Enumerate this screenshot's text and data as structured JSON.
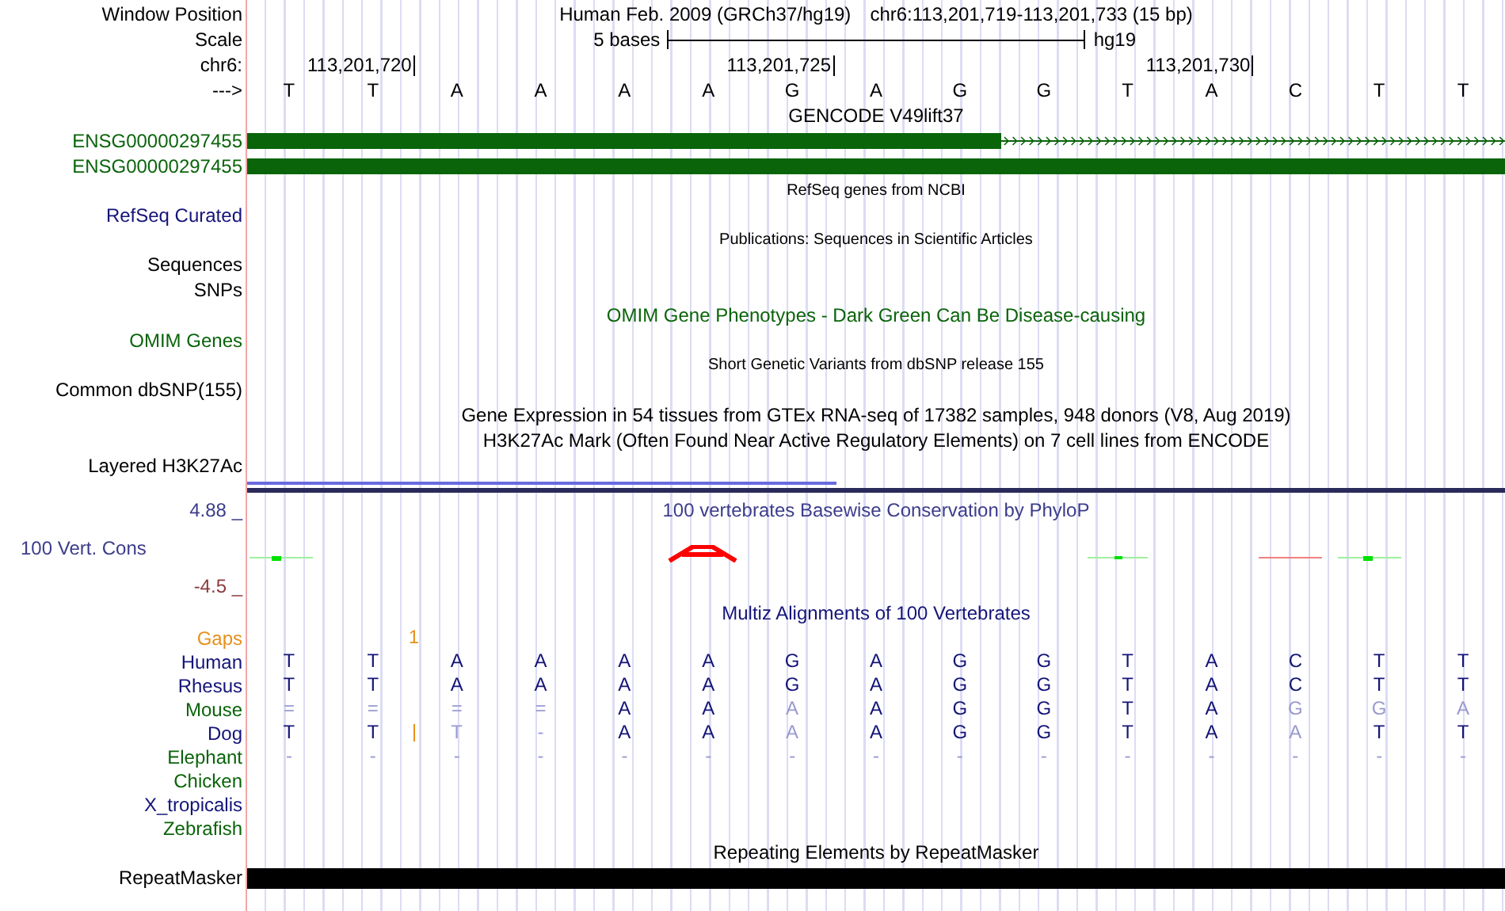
{
  "header": {
    "window_label": "Window Position",
    "assembly": "Human Feb. 2009 (GRCh37/hg19)",
    "position": "chr6:113,201,719-113,201,733 (15 bp)",
    "scale_label": "Scale",
    "scale_text": "5 bases",
    "scale_assembly": "hg19",
    "chrom_label": "chr6:",
    "ruler_ticks": [
      "113,201,720",
      "113,201,725",
      "113,201,730"
    ],
    "strand_label": "--->",
    "bases": [
      "T",
      "T",
      "A",
      "A",
      "A",
      "A",
      "G",
      "A",
      "G",
      "G",
      "T",
      "A",
      "C",
      "T",
      "T"
    ]
  },
  "tracks": [
    {
      "kind": "title",
      "text": "GENCODE V49lift37",
      "color": "#000000"
    },
    {
      "kind": "gene",
      "label": "ENSG00000297455",
      "color": "#0a640a",
      "parts": [
        {
          "kind": "exon"
        },
        {
          "kind": "exon"
        },
        {
          "kind": "exon"
        },
        {
          "kind": "exon"
        },
        {
          "kind": "exon"
        },
        {
          "kind": "exon"
        },
        {
          "kind": "exon"
        },
        {
          "kind": "exon"
        },
        {
          "kind": "exon"
        },
        {
          "kind": "intron"
        },
        {
          "kind": "intron"
        },
        {
          "kind": "intron"
        },
        {
          "kind": "intron"
        },
        {
          "kind": "intron"
        },
        {
          "kind": "intron"
        }
      ]
    },
    {
      "kind": "gene",
      "label": "ENSG00000297455",
      "color": "#0a640a",
      "parts": [
        {
          "kind": "exon"
        },
        {
          "kind": "exon"
        },
        {
          "kind": "exon"
        },
        {
          "kind": "exon"
        },
        {
          "kind": "exon"
        },
        {
          "kind": "exon"
        },
        {
          "kind": "exon"
        },
        {
          "kind": "exon"
        },
        {
          "kind": "exon"
        },
        {
          "kind": "exon"
        },
        {
          "kind": "exon"
        },
        {
          "kind": "exon"
        },
        {
          "kind": "exon"
        },
        {
          "kind": "exon"
        },
        {
          "kind": "exon"
        }
      ]
    },
    {
      "kind": "small-title",
      "text": "RefSeq genes from NCBI",
      "color": "#000000"
    },
    {
      "kind": "label",
      "label": "RefSeq Curated",
      "color": "#141478"
    },
    {
      "kind": "small-title",
      "text": "Publications: Sequences in Scientific Articles",
      "color": "#000000"
    },
    {
      "kind": "label",
      "label": "Sequences",
      "color": "#000000"
    },
    {
      "kind": "label",
      "label": "SNPs",
      "color": "#000000"
    },
    {
      "kind": "title",
      "text": "OMIM Gene Phenotypes - Dark Green Can Be Disease-causing",
      "color": "#0a640a"
    },
    {
      "kind": "label",
      "label": "OMIM Genes",
      "color": "#0a640a"
    },
    {
      "kind": "small-title",
      "text": "Short Genetic Variants from dbSNP release 155",
      "color": "#000000"
    },
    {
      "kind": "label",
      "label": "Common dbSNP(155)",
      "color": "#000000"
    },
    {
      "kind": "title",
      "text": "Gene Expression in 54 tissues from GTEx RNA-seq of 17382 samples, 948 donors (V8, Aug 2019)",
      "color": "#000000"
    },
    {
      "kind": "title",
      "text": "H3K27Ac Mark (Often Found Near Active Regulatory Elements) on 7 cell lines from ENCODE",
      "color": "#000000"
    },
    {
      "kind": "label",
      "label": "Layered H3K27Ac",
      "color": "#000000"
    },
    {
      "kind": "signal"
    },
    {
      "kind": "conservation",
      "title": "100 vertebrates Basewise Conservation by PhyloP",
      "label": "100 Vert. Cons",
      "color": "#3c3c8c",
      "y_max": "4.88 _",
      "y_min": "-4.5 _"
    },
    {
      "kind": "alignment",
      "title": "Multiz Alignments of 100 Vertebrates",
      "color": "#141478",
      "gaps": {
        "label": "Gaps",
        "color": "#e8901c",
        "cells": [
          {},
          {},
          {
            "count": "1"
          },
          {},
          {},
          {},
          {},
          {},
          {},
          {},
          {},
          {},
          {},
          {},
          {}
        ]
      },
      "species": [
        {
          "label": "Human",
          "color": "#141478",
          "cells": [
            {
              "base": "T",
              "faded": false,
              "insertion": false
            },
            {
              "base": "T",
              "faded": false,
              "insertion": false
            },
            {
              "base": "A",
              "faded": false,
              "insertion": false
            },
            {
              "base": "A",
              "faded": false,
              "insertion": false
            },
            {
              "base": "A",
              "faded": false,
              "insertion": false
            },
            {
              "base": "A",
              "faded": false,
              "insertion": false
            },
            {
              "base": "G",
              "faded": false,
              "insertion": false
            },
            {
              "base": "A",
              "faded": false,
              "insertion": false
            },
            {
              "base": "G",
              "faded": false,
              "insertion": false
            },
            {
              "base": "G",
              "faded": false,
              "insertion": false
            },
            {
              "base": "T",
              "faded": false,
              "insertion": false
            },
            {
              "base": "A",
              "faded": false,
              "insertion": false
            },
            {
              "base": "C",
              "faded": false,
              "insertion": false
            },
            {
              "base": "T",
              "faded": false,
              "insertion": false
            },
            {
              "base": "T",
              "faded": false,
              "insertion": false
            }
          ]
        },
        {
          "label": "Rhesus",
          "color": "#141478",
          "cells": [
            {
              "base": "T",
              "faded": false,
              "insertion": false
            },
            {
              "base": "T",
              "faded": false,
              "insertion": false
            },
            {
              "base": "A",
              "faded": false,
              "insertion": false
            },
            {
              "base": "A",
              "faded": false,
              "insertion": false
            },
            {
              "base": "A",
              "faded": false,
              "insertion": false
            },
            {
              "base": "A",
              "faded": false,
              "insertion": false
            },
            {
              "base": "G",
              "faded": false,
              "insertion": false
            },
            {
              "base": "A",
              "faded": false,
              "insertion": false
            },
            {
              "base": "G",
              "faded": false,
              "insertion": false
            },
            {
              "base": "G",
              "faded": false,
              "insertion": false
            },
            {
              "base": "T",
              "faded": false,
              "insertion": false
            },
            {
              "base": "A",
              "faded": false,
              "insertion": false
            },
            {
              "base": "C",
              "faded": false,
              "insertion": false
            },
            {
              "base": "T",
              "faded": false,
              "insertion": false
            },
            {
              "base": "T",
              "faded": false,
              "insertion": false
            }
          ]
        },
        {
          "label": "Mouse",
          "color": "#0a640a",
          "cells": [
            {
              "base": "=",
              "faded": true,
              "insertion": false
            },
            {
              "base": "=",
              "faded": true,
              "insertion": false
            },
            {
              "base": "=",
              "faded": true,
              "insertion": false
            },
            {
              "base": "=",
              "faded": true,
              "insertion": false
            },
            {
              "base": "A",
              "faded": false,
              "insertion": false
            },
            {
              "base": "A",
              "faded": false,
              "insertion": false
            },
            {
              "base": "A",
              "faded": true,
              "insertion": false
            },
            {
              "base": "A",
              "faded": false,
              "insertion": false
            },
            {
              "base": "G",
              "faded": false,
              "insertion": false
            },
            {
              "base": "G",
              "faded": false,
              "insertion": false
            },
            {
              "base": "T",
              "faded": false,
              "insertion": false
            },
            {
              "base": "A",
              "faded": false,
              "insertion": false
            },
            {
              "base": "G",
              "faded": true,
              "insertion": false
            },
            {
              "base": "G",
              "faded": true,
              "insertion": false
            },
            {
              "base": "A",
              "faded": true,
              "insertion": false
            }
          ]
        },
        {
          "label": "Dog",
          "color": "#141478",
          "cells": [
            {
              "base": "T",
              "faded": false,
              "insertion": false
            },
            {
              "base": "T",
              "faded": false,
              "insertion": false
            },
            {
              "base": "T",
              "faded": true,
              "insertion": true
            },
            {
              "base": "-",
              "faded": true,
              "insertion": false
            },
            {
              "base": "A",
              "faded": false,
              "insertion": false
            },
            {
              "base": "A",
              "faded": false,
              "insertion": false
            },
            {
              "base": "A",
              "faded": true,
              "insertion": false
            },
            {
              "base": "A",
              "faded": false,
              "insertion": false
            },
            {
              "base": "G",
              "faded": false,
              "insertion": false
            },
            {
              "base": "G",
              "faded": false,
              "insertion": false
            },
            {
              "base": "T",
              "faded": false,
              "insertion": false
            },
            {
              "base": "A",
              "faded": false,
              "insertion": false
            },
            {
              "base": "A",
              "faded": true,
              "insertion": false
            },
            {
              "base": "T",
              "faded": false,
              "insertion": false
            },
            {
              "base": "T",
              "faded": false,
              "insertion": false
            }
          ]
        },
        {
          "label": "Elephant",
          "color": "#0a640a",
          "cells": [
            {
              "base": "-",
              "faded": true,
              "insertion": false
            },
            {
              "base": "-",
              "faded": true,
              "insertion": false
            },
            {
              "base": "-",
              "faded": true,
              "insertion": false
            },
            {
              "base": "-",
              "faded": true,
              "insertion": false
            },
            {
              "base": "-",
              "faded": true,
              "insertion": false
            },
            {
              "base": "-",
              "faded": true,
              "insertion": false
            },
            {
              "base": "-",
              "faded": true,
              "insertion": false
            },
            {
              "base": "-",
              "faded": true,
              "insertion": false
            },
            {
              "base": "-",
              "faded": true,
              "insertion": false
            },
            {
              "base": "-",
              "faded": true,
              "insertion": false
            },
            {
              "base": "-",
              "faded": true,
              "insertion": false
            },
            {
              "base": "-",
              "faded": true,
              "insertion": false
            },
            {
              "base": "-",
              "faded": true,
              "insertion": false
            },
            {
              "base": "-",
              "faded": true,
              "insertion": false
            },
            {
              "base": "-",
              "faded": true,
              "insertion": false
            }
          ]
        },
        {
          "label": "Chicken",
          "color": "#0a640a"
        },
        {
          "label": "X_tropicalis",
          "color": "#141478"
        },
        {
          "label": "Zebrafish",
          "color": "#0a640a"
        }
      ]
    },
    {
      "kind": "title",
      "text": "Repeating Elements by RepeatMasker",
      "color": "#000000"
    },
    {
      "kind": "repeat",
      "label": "RepeatMasker",
      "color": "#000000"
    }
  ]
}
